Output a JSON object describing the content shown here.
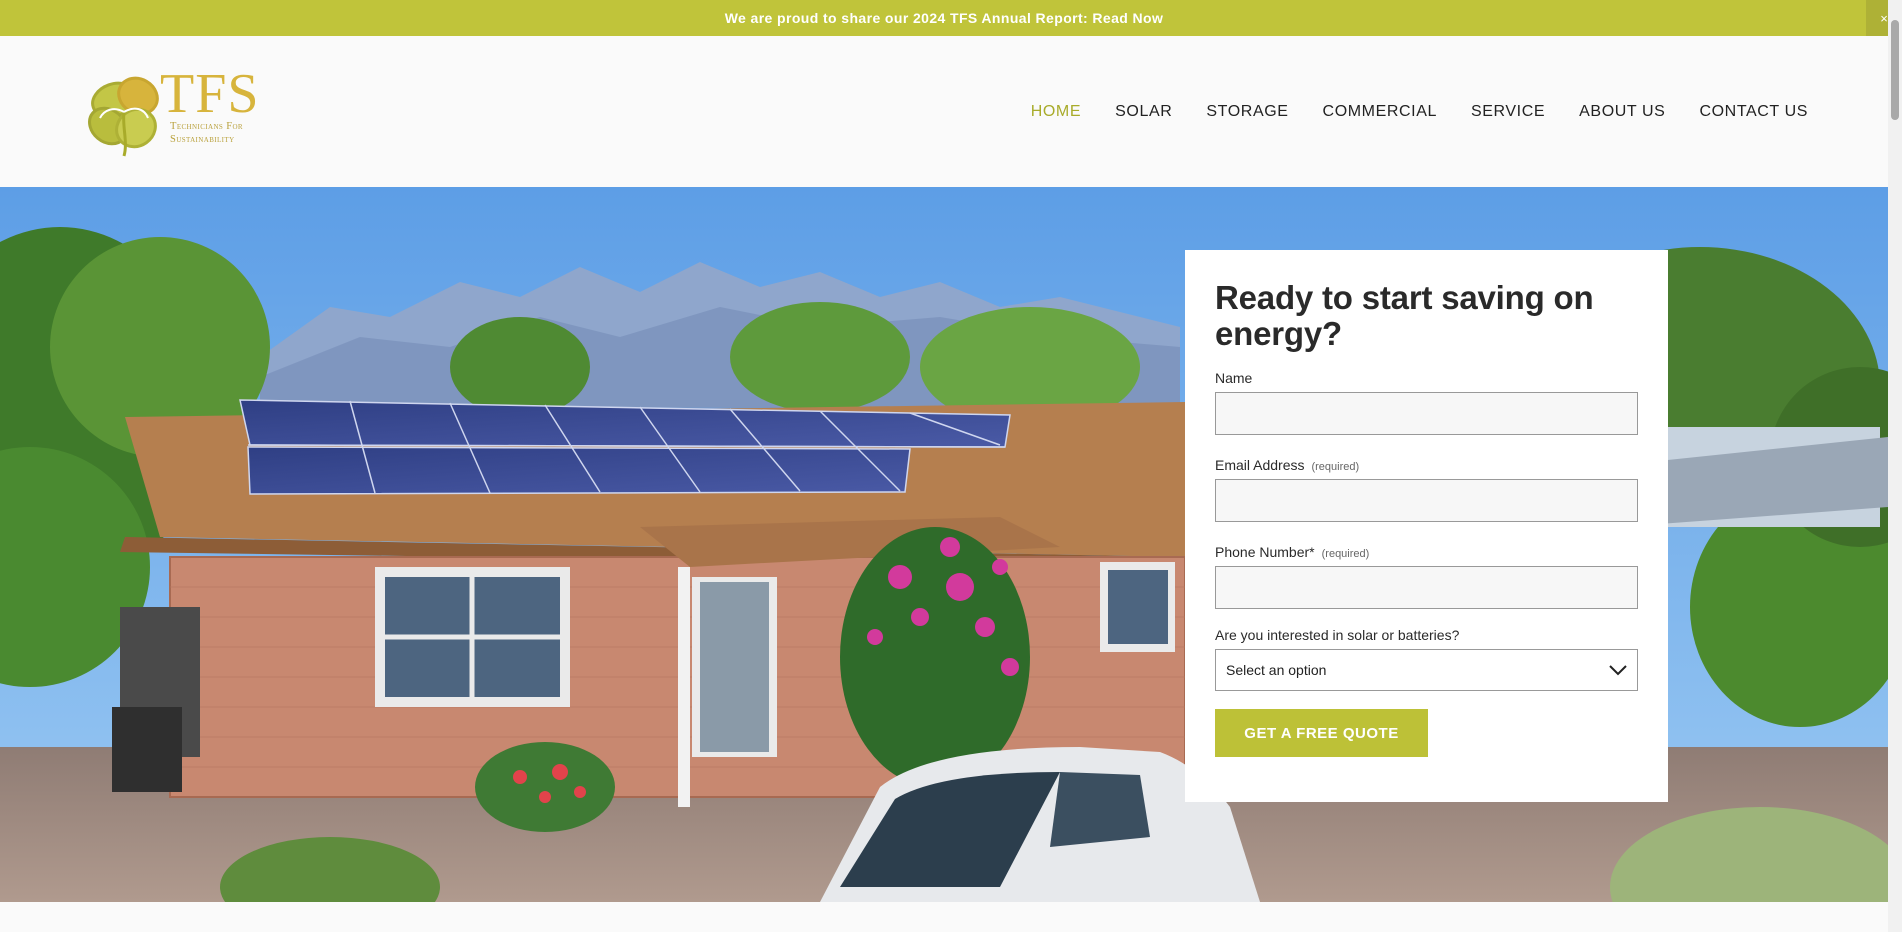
{
  "announcement": {
    "text": "We are proud to share our 2024 TFS Annual Report: Read Now",
    "close": "×"
  },
  "logo": {
    "name": "TFS",
    "tagline_line1": "Technicians For",
    "tagline_line2": "Sustainability"
  },
  "nav": {
    "items": [
      {
        "label": "HOME",
        "active": true
      },
      {
        "label": "SOLAR",
        "active": false
      },
      {
        "label": "STORAGE",
        "active": false
      },
      {
        "label": "COMMERCIAL",
        "active": false
      },
      {
        "label": "SERVICE",
        "active": false
      },
      {
        "label": "ABOUT US",
        "active": false
      },
      {
        "label": "CONTACT US",
        "active": false
      }
    ]
  },
  "form": {
    "title": "Ready to start saving on energy?",
    "name_label": "Name",
    "email_label": "Email Address",
    "email_required": "(required)",
    "phone_label": "Phone Number*",
    "phone_required": "(required)",
    "interest_label": "Are you interested in solar or batteries?",
    "interest_value": "Select an option",
    "submit_label": "GET A FREE QUOTE"
  },
  "colors": {
    "accent": "#c0c43a",
    "button": "#bdc137",
    "logo_gold": "#d7b43c",
    "nav_active": "#a8ab2a"
  }
}
